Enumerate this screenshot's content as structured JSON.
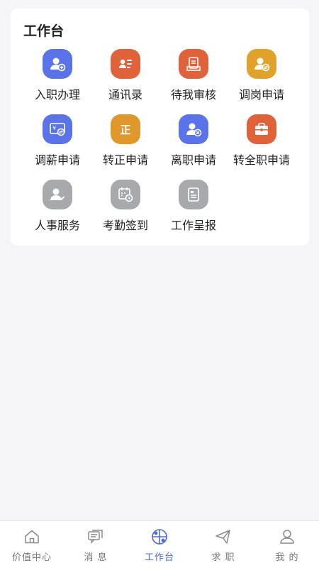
{
  "workbench": {
    "title": "工作台",
    "items": [
      {
        "label": "入职办理",
        "icon": "user-add-icon",
        "color": "#5b73e8"
      },
      {
        "label": "通讯录",
        "icon": "contact-card-icon",
        "color": "#e0623b"
      },
      {
        "label": "待我审核",
        "icon": "document-stamp-icon",
        "color": "#e0623b"
      },
      {
        "label": "调岗申请",
        "icon": "user-transfer-icon",
        "color": "#e0a22a"
      },
      {
        "label": "调薪申请",
        "icon": "salary-adjust-icon",
        "color": "#5b73e8"
      },
      {
        "label": "转正申请",
        "icon": "regular-badge-icon",
        "color": "#e0982c"
      },
      {
        "label": "离职申请",
        "icon": "user-remove-icon",
        "color": "#5b73e8"
      },
      {
        "label": "转全职申请",
        "icon": "briefcase-icon",
        "color": "#e0623b"
      },
      {
        "label": "人事服务",
        "icon": "user-check-icon",
        "color": "#a7a9ad"
      },
      {
        "label": "考勤签到",
        "icon": "calendar-clock-icon",
        "color": "#a7a9ad"
      },
      {
        "label": "工作呈报",
        "icon": "report-document-icon",
        "color": "#a7a9ad"
      }
    ]
  },
  "tabbar": {
    "active_color": "#4c6bd6",
    "tabs": [
      {
        "label": "价值中心",
        "icon": "home-icon"
      },
      {
        "label": "消 息",
        "icon": "message-icon"
      },
      {
        "label": "工作台",
        "icon": "workbench-icon",
        "active": true
      },
      {
        "label": "求 职",
        "icon": "paper-plane-icon"
      },
      {
        "label": "我 的",
        "icon": "profile-icon"
      }
    ]
  }
}
